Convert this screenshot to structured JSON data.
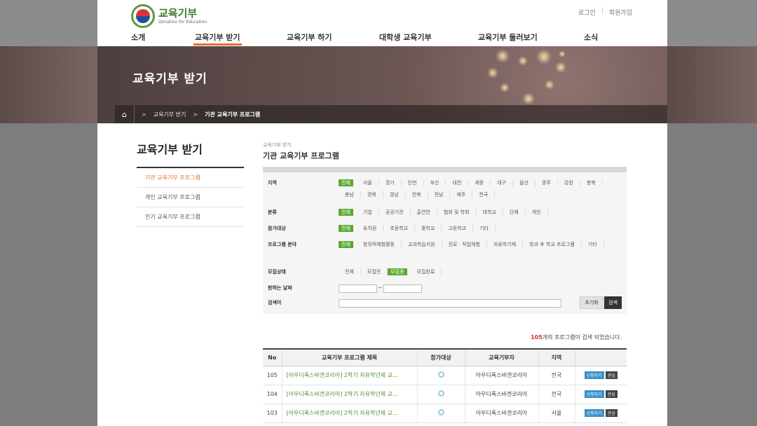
{
  "logo": {
    "korean": "교육기부",
    "english": "Donation for Education"
  },
  "util": {
    "login": "로그인",
    "sep": "|",
    "join": "회원가입"
  },
  "gnb": [
    "소개",
    "교육기부 받기",
    "교육기부 하기",
    "대학생 교육기부",
    "교육기부 둘러보기",
    "소식"
  ],
  "banner": {
    "title": "교육기부 받기"
  },
  "breadcrumb": {
    "level1": "교육기부 받기",
    "level2": "기관 교육기부 프로그램",
    "arrow": ">"
  },
  "lnb": {
    "title": "교육기부 받기",
    "items": [
      "기관 교육기부 프로그램",
      "개인 교육기부 프로그램",
      "인기 교육기부 프로그램"
    ]
  },
  "content": {
    "loc_small": "교육기부 받기",
    "loc_title": "기관 교육기부 프로그램"
  },
  "filters": {
    "region": {
      "label": "지역",
      "options": [
        "전체",
        "서울",
        "경기",
        "인천",
        "부산",
        "대전",
        "세종",
        "대구",
        "울산",
        "광주",
        "강원",
        "충북",
        "충남",
        "경북",
        "경남",
        "전북",
        "전남",
        "제주",
        "전국"
      ]
    },
    "category": {
      "label": "분류",
      "options": [
        "전체",
        "기업",
        "공공기관",
        "출연연",
        "협회 및 학회",
        "대학교",
        "단체",
        "개인"
      ]
    },
    "target": {
      "label": "참가대상",
      "options": [
        "전체",
        "유치원",
        "초등학교",
        "중학교",
        "고등학교",
        "기타"
      ]
    },
    "field": {
      "label": "프로그램 분야",
      "options": [
        "전체",
        "창의적체험활동",
        "교과학습지원",
        "진로 · 직업체험",
        "자유학기제",
        "방과 후 학교 프로그램",
        "기타"
      ]
    },
    "status": {
      "label": "모집상태",
      "options": [
        "전체",
        "모집전",
        "모집중",
        "모집완료"
      ]
    },
    "date": {
      "label": "원하는 날짜",
      "dash": "~"
    },
    "keyword": {
      "label": "검색어"
    },
    "reset_label": "초기화",
    "search_label": "검색"
  },
  "result": {
    "count": "105",
    "text": "개의 프로그램이 검색 되었습니다."
  },
  "table": {
    "headers": [
      "No",
      "교육기부 프로그램 제목",
      "참가대상",
      "교육기부자",
      "지역",
      ""
    ],
    "apply_label": "신청하기",
    "like_label": "관심",
    "rows": [
      {
        "no": "105",
        "title": "[아우디폭스바겐코리아] 2학기 자유학년제 교...",
        "donor": "아우디폭스바겐코리아",
        "region": "전국"
      },
      {
        "no": "104",
        "title": "[아우디폭스바겐코리아] 2학기 자유학년제 교...",
        "donor": "아우디폭스바겐코리아",
        "region": "전국"
      },
      {
        "no": "103",
        "title": "[아우디폭스바겐코리아] 2학기 자유학년제 교...",
        "donor": "아우디폭스바겐코리아",
        "region": "서울"
      }
    ]
  },
  "colors": {
    "accent": "#e0722f",
    "selected": "#5aaa33",
    "apply": "#3a8fc9",
    "count": "#d32c2c"
  }
}
